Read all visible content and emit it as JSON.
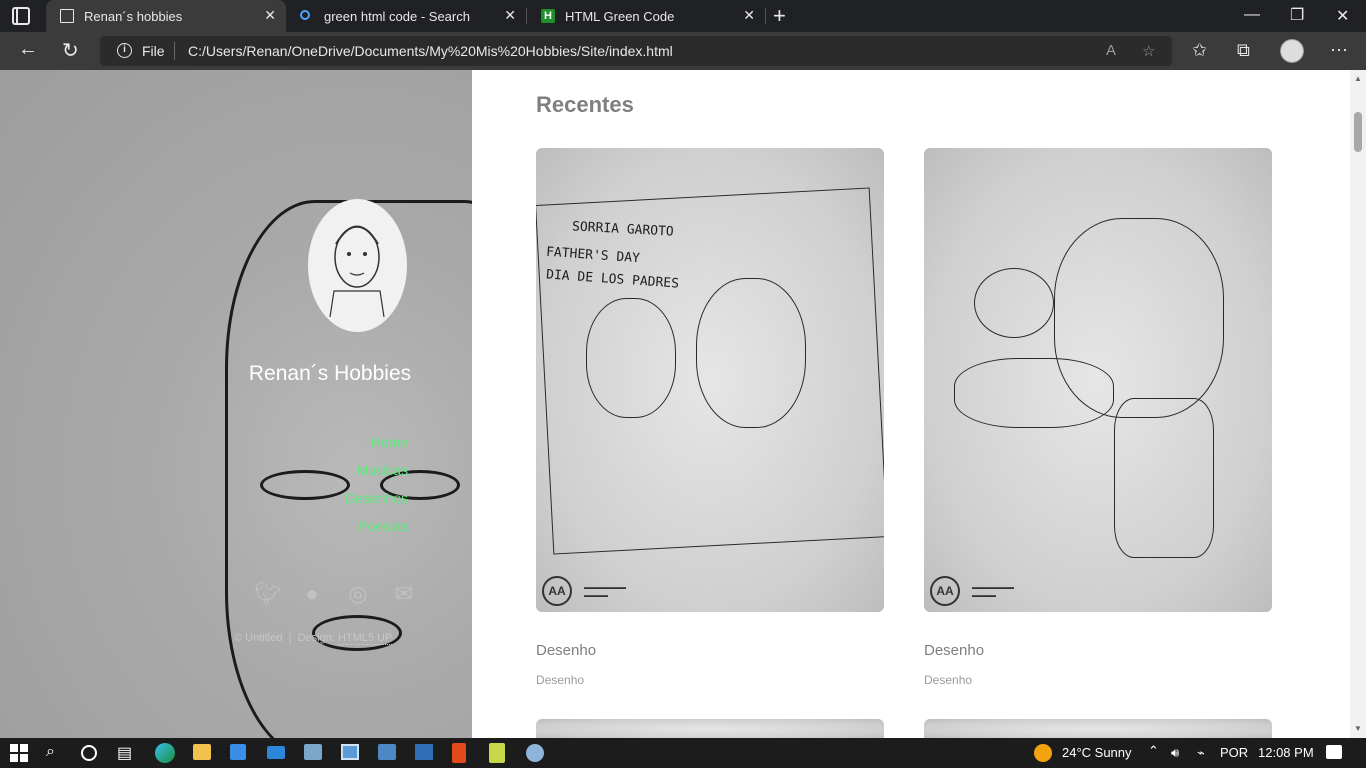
{
  "browser": {
    "tabs": [
      {
        "title": "Renan´s hobbies",
        "active": true,
        "icon": "page-icon"
      },
      {
        "title": "green html code - Search",
        "active": false,
        "icon": "search-icon"
      },
      {
        "title": "HTML Green Code",
        "active": false,
        "icon": "html-h-icon"
      }
    ],
    "address": {
      "scheme_label": "File",
      "url": "C:/Users/Renan/OneDrive/Documents/My%20Mis%20Hobbies/Site/index.html"
    }
  },
  "sidebar": {
    "site_title": "Renan´s Hobbies",
    "nav": [
      "Home",
      "Musicas",
      "Desenhos",
      "Poesias"
    ],
    "social_icons": [
      "twitter-icon",
      "github-icon",
      "dribbble-icon",
      "email-icon"
    ],
    "credits": {
      "copyright": "© Untitled",
      "separator": "|",
      "design_label": "Design:",
      "design_link": "HTML5 UP"
    },
    "link_color": "#5ee87d"
  },
  "main": {
    "section_title": "Recentes",
    "cards": [
      {
        "title": "Desenho",
        "subtitle": "Desenho",
        "sketch_text": [
          "SORRIA GAROTO",
          "FATHER'S DAY",
          "DIA DE LOS PADRES"
        ]
      },
      {
        "title": "Desenho",
        "subtitle": "Desenho"
      }
    ]
  },
  "taskbar": {
    "weather": "24°C  Sunny",
    "language": "POR",
    "time": "12:08 PM"
  }
}
